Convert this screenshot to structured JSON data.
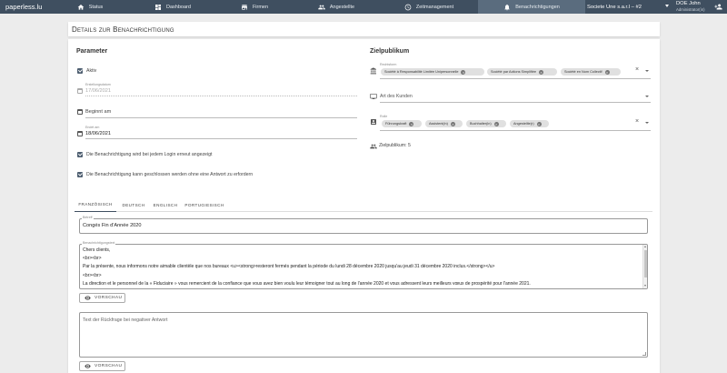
{
  "nav": {
    "brand": "paperless.lu",
    "items": [
      {
        "label": "Status",
        "icon": "home-icon"
      },
      {
        "label": "Dashboard",
        "icon": "dashboard-icon"
      },
      {
        "label": "Firmen",
        "icon": "store-icon"
      },
      {
        "label": "Angestellte",
        "icon": "people-icon"
      },
      {
        "label": "Zeitmanagement",
        "icon": "clock-icon"
      },
      {
        "label": "Benachrichtigungen",
        "icon": "bell-icon"
      }
    ],
    "company": "Societe Une s.a.r.l – #2",
    "user_name": "DOE John",
    "user_role": "Administrator(in)"
  },
  "page": {
    "title": "Details zur Benachrichtigung"
  },
  "parameter": {
    "title": "Parameter",
    "active_label": "Aktiv",
    "created_label": "Erstellungsdatum",
    "created_value": "17/06/2021",
    "start_placeholder": "Beginnt am",
    "end_label": "Endet am",
    "end_value": "18/06/2021",
    "show_each_login": "Die Benachrichtigung wird bei jedem Login erneut angezeigt",
    "closable": "Die Benachrichtigung kann geschlossen werden ohne eine Antwort zu erfordern"
  },
  "audience": {
    "title": "Zielpublikum",
    "legal_form_label": "Rechtsform",
    "legal_forms": [
      "Société à Responsabilité Limitée Unipersonnelle",
      "Société par Actions Simplifiée",
      "Société en Nom Collectif"
    ],
    "customer_type_placeholder": "Art des Kunden",
    "role_label": "Rolle",
    "roles": [
      "Führungskraft",
      "Assistent(in)",
      "Buchhalter(in)",
      "Angestellte(r)"
    ],
    "count_text": "Zielpublikum: 5"
  },
  "tabs": [
    "FRANZÖSISCH",
    "DEUTSCH",
    "ENGLISCH",
    "PORTUGIESISCH"
  ],
  "content": {
    "subject_label": "Betreff",
    "subject_value": "Congés Fin d'Année 2020",
    "body_label": "Benachrichtigungstext",
    "body_lines": [
      "Chers clients,",
      "<br><br>",
      "Par la présente, nous informons notre aimable clientèle que nos bureaux <u><strong>resteront fermés pendant la période du lundi 28 décembre 2020 jusqu'au jeudi 31 décembre 2020 inclus.</strong></u>",
      "<br><br>",
      "La direction et le personnel de la « Fiduciaire » vous remercient de la confiance que vous avez bien voulu leur témoigner tout au long de l'année 2020 et vous adressent leurs meilleurs vœux de prospérité pour l'année 2021."
    ],
    "preview_label": "VORSCHAU",
    "negative_reply_placeholder": "Text der Rückfrage bei negativer Antwort",
    "preview_label_2": "VORSCHAU"
  }
}
